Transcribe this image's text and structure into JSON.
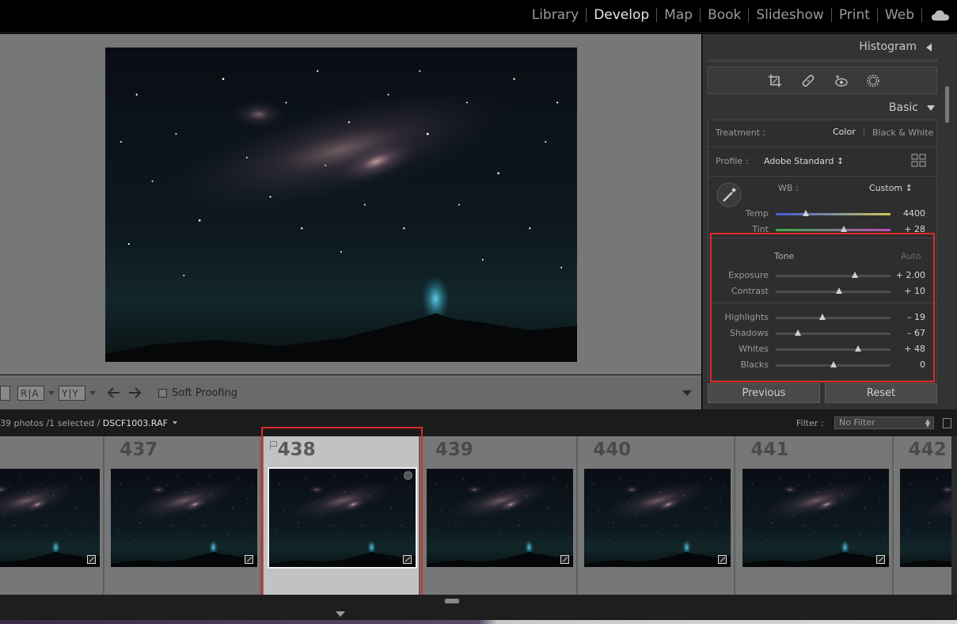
{
  "modules": [
    "Library",
    "Develop",
    "Map",
    "Book",
    "Slideshow",
    "Print",
    "Web"
  ],
  "active_module": "Develop",
  "toolbar": {
    "ra_label": "R|A",
    "yy_label": "Y|Y",
    "soft_proofing": "Soft Proofing"
  },
  "panel": {
    "histogram_title": "Histogram",
    "basic_title": "Basic",
    "treatment_label": "Treatment :",
    "treatment_color": "Color",
    "treatment_bw": "Black & White",
    "profile_label": "Profile :",
    "profile_value": "Adobe Standard ↕",
    "wb_label": "WB :",
    "wb_value": "Custom ↕",
    "temp_label": "Temp",
    "temp_value": "4400",
    "temp_pos": 0.26,
    "tint_label": "Tint",
    "tint_value": "+ 28",
    "tint_pos": 0.59,
    "tone_label": "Tone",
    "auto_label": "Auto",
    "sliders": [
      {
        "label": "Exposure",
        "value": "+ 2.00",
        "pos": 0.69
      },
      {
        "label": "Contrast",
        "value": "+ 10",
        "pos": 0.55
      },
      {
        "label": "Highlights",
        "value": "– 19",
        "pos": 0.41
      },
      {
        "label": "Shadows",
        "value": "– 67",
        "pos": 0.19
      },
      {
        "label": "Whites",
        "value": "+ 48",
        "pos": 0.72
      },
      {
        "label": "Blacks",
        "value": "0",
        "pos": 0.5
      }
    ],
    "previous_label": "Previous",
    "reset_label": "Reset"
  },
  "filmstrip": {
    "info_prefix": "39 photos /1 selected /",
    "filename": "DSCF1003.RAF",
    "filter_label": "Filter :",
    "filter_value": "No Filter",
    "cells": [
      {
        "num": ""
      },
      {
        "num": "437"
      },
      {
        "num": "438",
        "selected": true
      },
      {
        "num": "439"
      },
      {
        "num": "440"
      },
      {
        "num": "441"
      },
      {
        "num": "442"
      }
    ]
  },
  "colors": {
    "highlight_box": "#e02a25"
  }
}
